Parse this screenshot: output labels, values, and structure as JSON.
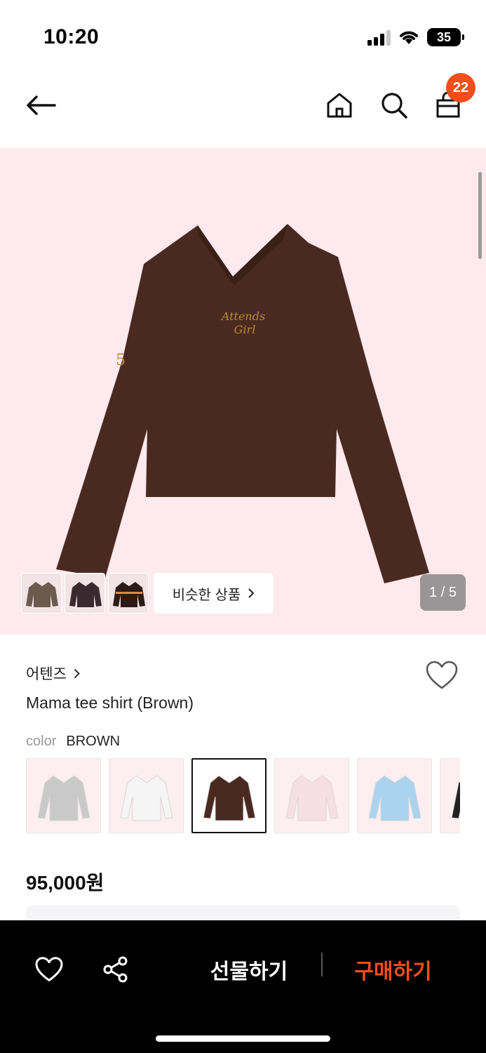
{
  "status_bar": {
    "time": "10:20",
    "battery": "35"
  },
  "header": {
    "cart_count": "22",
    "icons": [
      "back-arrow-icon",
      "home-icon",
      "search-icon",
      "cart-icon"
    ]
  },
  "hero": {
    "pager": "1 / 5",
    "similar_label": "비슷한 상품",
    "shirt_color": "#4a2a20",
    "background": "#fde9ee"
  },
  "product": {
    "brand": "어텐즈",
    "name": "Mama tee shirt (Brown)",
    "color_label": "color",
    "color_value": "BROWN",
    "swatch_colors": [
      "#c9c9c9",
      "#f5f5f5",
      "#4a2a20",
      "#f6dfe3",
      "#a9d3ee",
      "#222222"
    ],
    "selected_swatch": 2,
    "price": "95,000원"
  },
  "bottom_bar": {
    "gift_label": "선물하기",
    "buy_label": "구매하기",
    "accent": "#f24d1b"
  }
}
